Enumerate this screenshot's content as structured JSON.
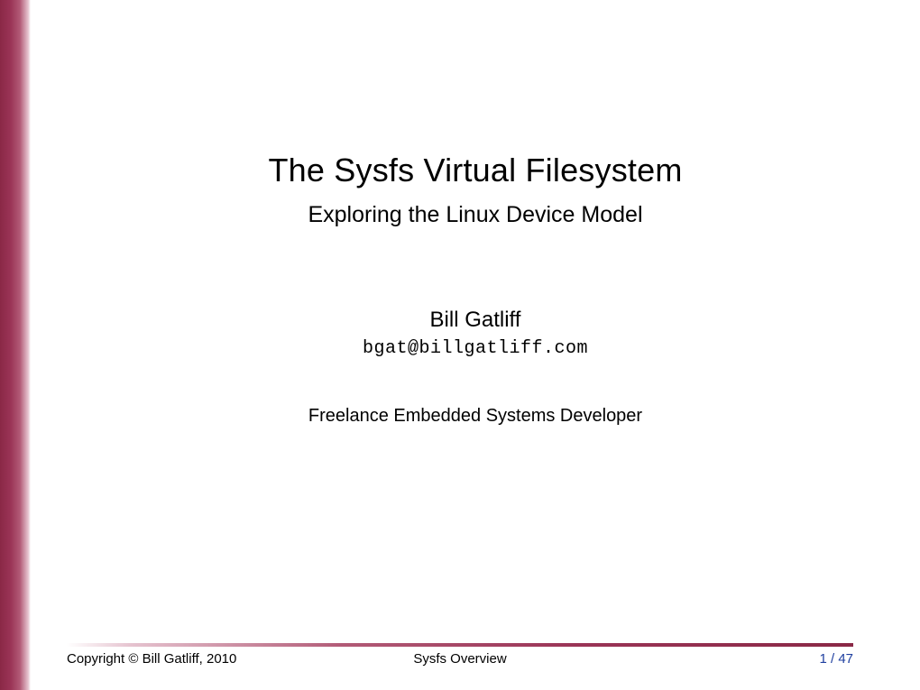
{
  "slide": {
    "title": "The Sysfs Virtual Filesystem",
    "subtitle": "Exploring the Linux Device Model",
    "author": "Bill Gatliff",
    "email": "bgat@billgatliff.com",
    "role": "Freelance Embedded Systems Developer"
  },
  "footer": {
    "copyright": "Copyright © Bill Gatliff, 2010",
    "section": "Sysfs Overview",
    "page": "1 / 47"
  }
}
